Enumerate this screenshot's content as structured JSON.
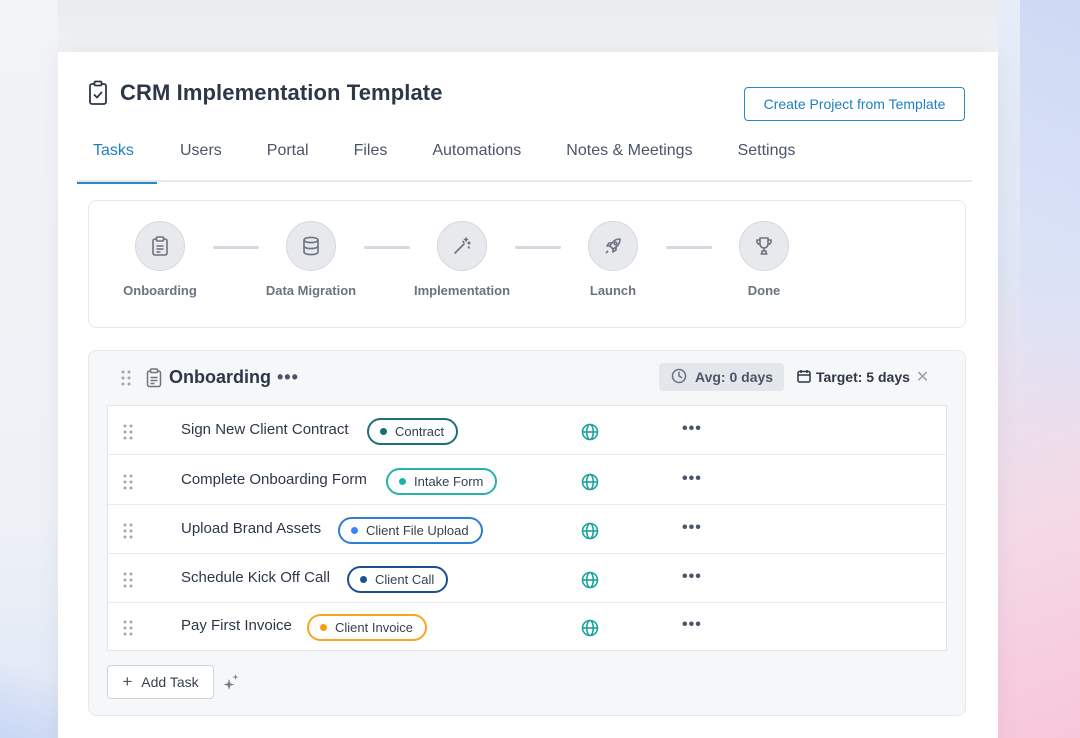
{
  "page": {
    "title": "CRM Implementation Template",
    "create_button": "Create Project from Template"
  },
  "tabs": [
    {
      "label": "Tasks",
      "active": true
    },
    {
      "label": "Users",
      "active": false
    },
    {
      "label": "Portal",
      "active": false
    },
    {
      "label": "Files",
      "active": false
    },
    {
      "label": "Automations",
      "active": false
    },
    {
      "label": "Notes & Meetings",
      "active": false
    },
    {
      "label": "Settings",
      "active": false
    }
  ],
  "stages": [
    {
      "label": "Onboarding",
      "icon": "clipboard-icon"
    },
    {
      "label": "Data Migration",
      "icon": "database-icon"
    },
    {
      "label": "Implementation",
      "icon": "magic-wand-icon"
    },
    {
      "label": "Launch",
      "icon": "rocket-icon"
    },
    {
      "label": "Done",
      "icon": "trophy-icon"
    }
  ],
  "group": {
    "title": "Onboarding",
    "more": "•••",
    "avg_label": "Avg: 0 days",
    "target_label": "Target: 5 days"
  },
  "tasks": [
    {
      "name": "Sign New Client Contract",
      "tag": "Contract",
      "tag_color": "#1f6f78",
      "dot_color": "#176d6d"
    },
    {
      "name": "Complete Onboarding Form",
      "tag": "Intake Form",
      "tag_color": "#25b3a6",
      "dot_color": "#1fb3a4"
    },
    {
      "name": "Upload Brand Assets",
      "tag": "Client File Upload",
      "tag_color": "#2d7fd0",
      "dot_color": "#3b82f6"
    },
    {
      "name": "Schedule Kick Off Call",
      "tag": "Client Call",
      "tag_color": "#1d4f8f",
      "dot_color": "#1e4f91"
    },
    {
      "name": "Pay First Invoice",
      "tag": "Client Invoice",
      "tag_color": "#f5a623",
      "dot_color": "#f59e0b"
    }
  ],
  "row_more": "•••",
  "add_task_label": "Add Task",
  "colors": {
    "accent": "#2b8ac6",
    "globe": "#1aa39a"
  }
}
